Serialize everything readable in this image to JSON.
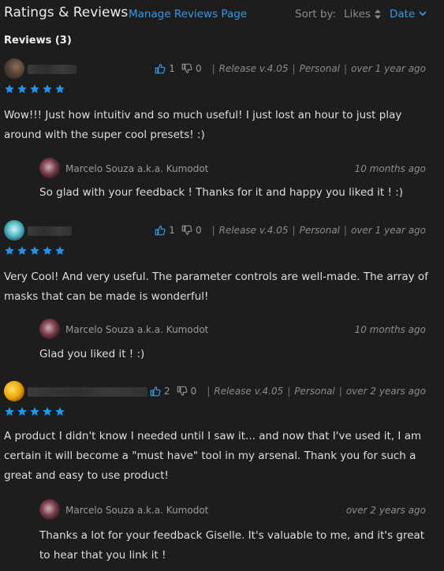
{
  "header": {
    "title": "Ratings & Reviews",
    "manage_link": "Manage Reviews Page",
    "sort_label": "Sort by:",
    "sort_likes": "Likes",
    "sort_date": "Date"
  },
  "reviews_heading": "Reviews (3)",
  "colors": {
    "accent": "#2f9be6",
    "star": "#1e96e8",
    "background": "#1d1d1d"
  },
  "reviews": [
    {
      "likes": "1",
      "dislikes": "0",
      "release": "Release v.4.05",
      "license": "Personal",
      "time": "over 1 year ago",
      "rating": 5,
      "text": "Wow!!! Just how intuitiv and so much useful! I just lost an hour to just play around with the super cool presets! :)",
      "reply": {
        "author": "Marcelo Souza a.k.a. Kumodot",
        "time": "10 months ago",
        "text": "So glad with your feedback ! Thanks for it and happy you liked it ! :)"
      }
    },
    {
      "likes": "1",
      "dislikes": "0",
      "release": "Release v.4.05",
      "license": "Personal",
      "time": "over 1 year ago",
      "rating": 5,
      "text": "Very Cool! And very useful. The parameter controls are well-made. The array of masks that can be made is wonderful!",
      "reply": {
        "author": "Marcelo Souza a.k.a. Kumodot",
        "time": "10 months ago",
        "text": "Glad you liked it ! :)"
      }
    },
    {
      "likes": "2",
      "dislikes": "0",
      "release": "Release v.4.05",
      "license": "Personal",
      "time": "over 2 years ago",
      "rating": 5,
      "text": "A product I didn't know I needed until I saw it... and now that I've used it, I am certain it will become a \"must have\" tool in my arsenal. Thank you for such a great and easy to use product!",
      "reply": {
        "author": "Marcelo Souza a.k.a. Kumodot",
        "time": "over 2 years ago",
        "text": "Thanks a lot for your feedback Giselle. It's valuable to me, and it's great to hear that you link it !"
      }
    }
  ]
}
